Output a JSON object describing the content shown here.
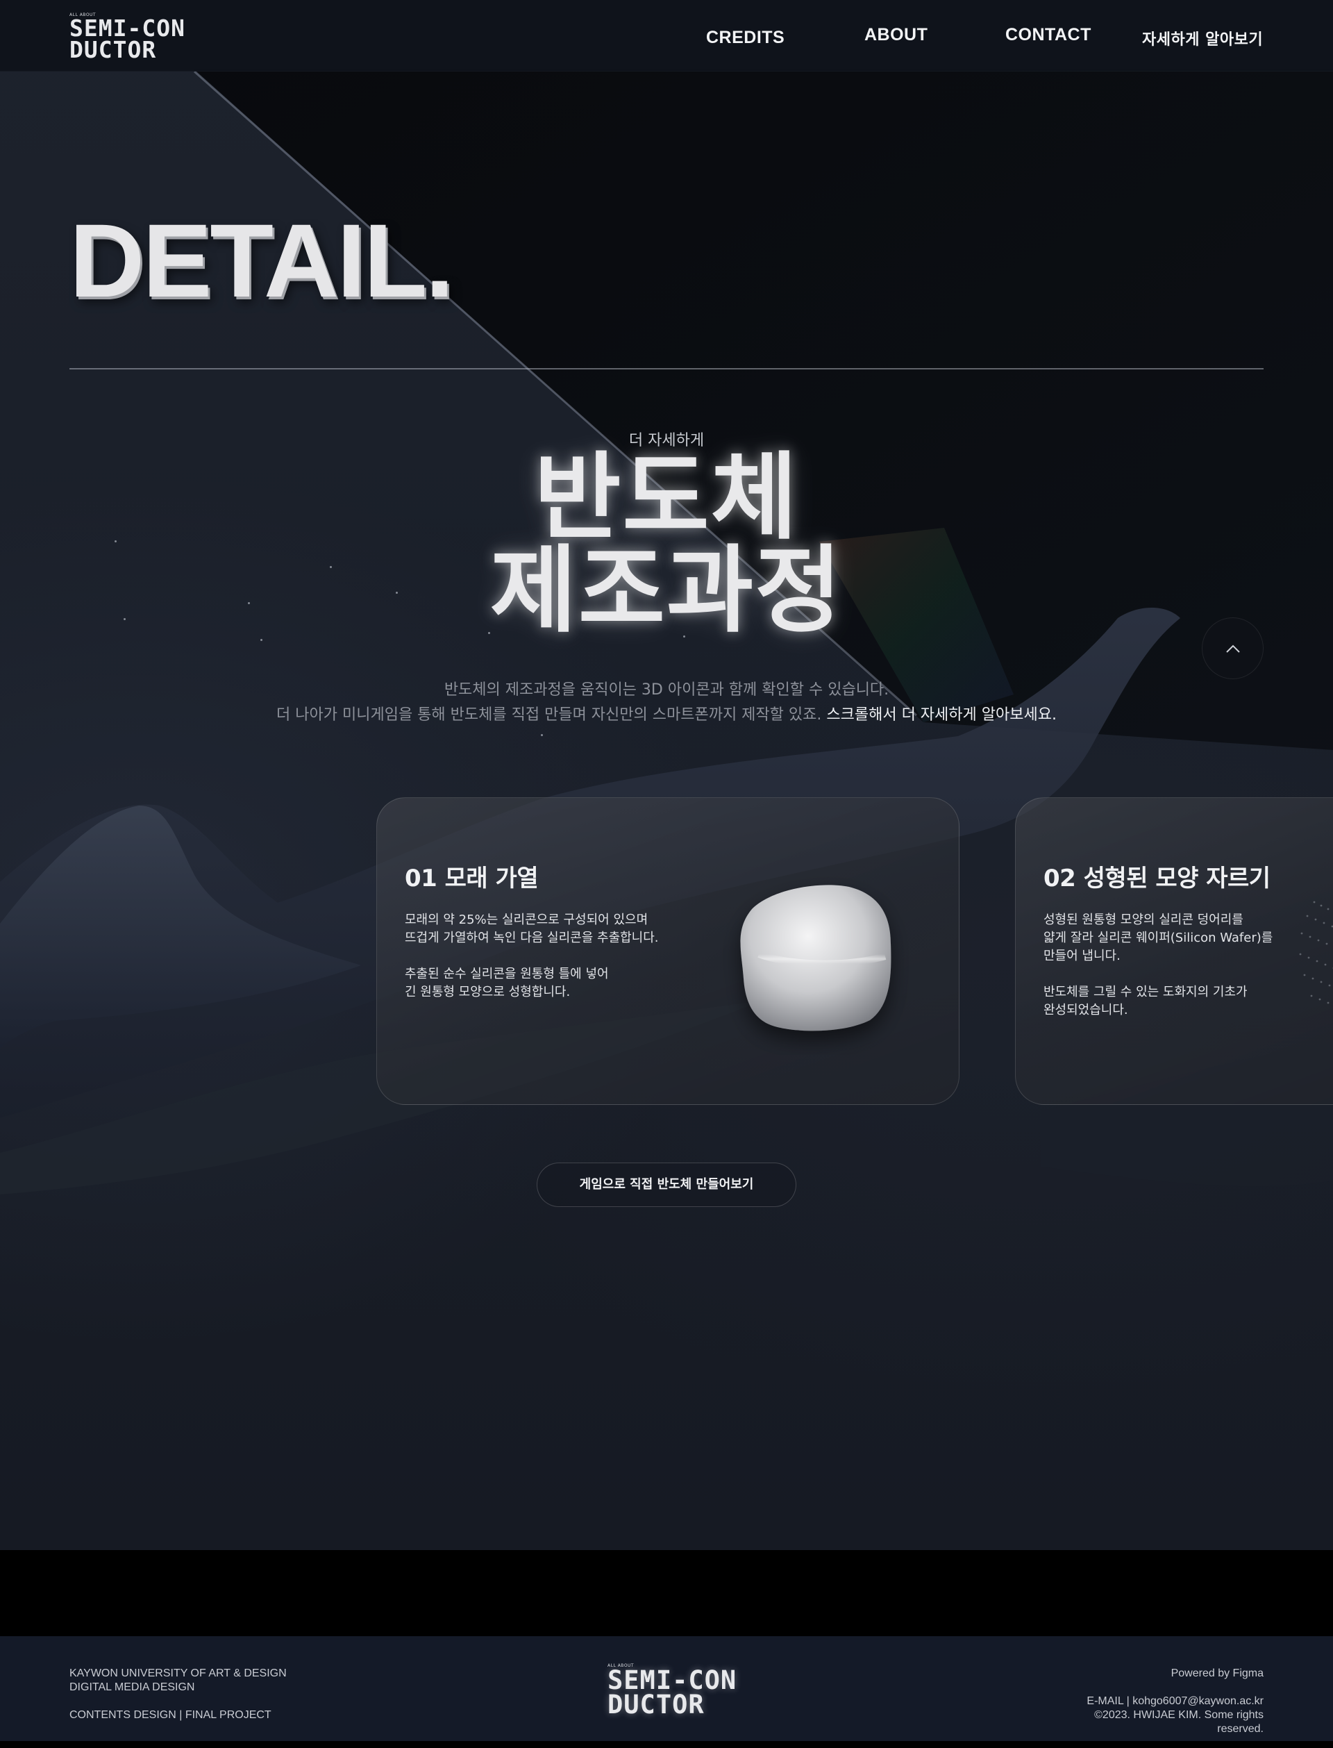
{
  "header": {
    "logo": {
      "small": "ALL ABOUT",
      "line1": "SEMI-CON",
      "line2": "DUCTOR"
    },
    "nav": [
      {
        "label": "CREDITS"
      },
      {
        "label": "ABOUT"
      },
      {
        "label": "CONTACT"
      },
      {
        "label": "자세하게 알아보기"
      }
    ]
  },
  "hero": {
    "title": "DETAIL.",
    "subtitle": "더 자세하게",
    "big_title_line1": "반도체",
    "big_title_line2": "제조과정",
    "desc_line1": "반도체의 제조과정을 움직이는 3D 아이콘과 함께 확인할 수 있습니다.",
    "desc_line2": "더 나아가 미니게임을 통해 반도체를 직접 만들며 자신만의 스마트폰까지 제작할 있죠.",
    "desc_highlight": "스크롤해서 더 자세하게 알아보세요."
  },
  "scroll_top": {
    "icon": "chevron-up-icon"
  },
  "cards": [
    {
      "title": "01 모래 가열",
      "p1_line1": "모래의 약 25%는 실리콘으로 구성되어 있으며",
      "p1_line2": "뜨겁게 가열하여 녹인 다음 실리콘을 추출합니다.",
      "p2_line1": "추출된 순수 실리콘을 원통형 틀에 넣어",
      "p2_line2": "긴 원통형 모양으로 성형합니다."
    },
    {
      "title": "02 성형된 모양 자르기",
      "p1_line1": "성형된 원통형 모양의 실리콘 덩어리를",
      "p1_line2": "얇게 잘라 실리콘 웨이퍼(Silicon Wafer)를",
      "p1_line3": "만들어 냅니다.",
      "p2_line1": "반도체를 그릴 수 있는 도화지의 기초가",
      "p2_line2": "완성되었습니다."
    }
  ],
  "game_button": {
    "label": "게임으로 직접 반도체 만들어보기"
  },
  "footer": {
    "left_line1": "KAYWON UNIVERSITY OF ART & DESIGN",
    "left_line2": "DIGITAL MEDIA DESIGN",
    "left_line3": "CONTENTS DESIGN | FINAL PROJECT",
    "logo": {
      "small": "ALL ABOUT",
      "line1": "SEMI-CON",
      "line2": "DUCTOR"
    },
    "powered": "Powered by Figma",
    "email": "E-MAIL | kohgo6007@kaywon.ac.kr",
    "copyright_line1": "©2023. HWIJAE KIM. Some rights",
    "copyright_line2": "reserved."
  },
  "colors": {
    "background": "#161b25",
    "header": "#0e121a",
    "footer": "#141a28",
    "text_primary": "#e6e7ea",
    "text_muted": "#8d919a"
  }
}
